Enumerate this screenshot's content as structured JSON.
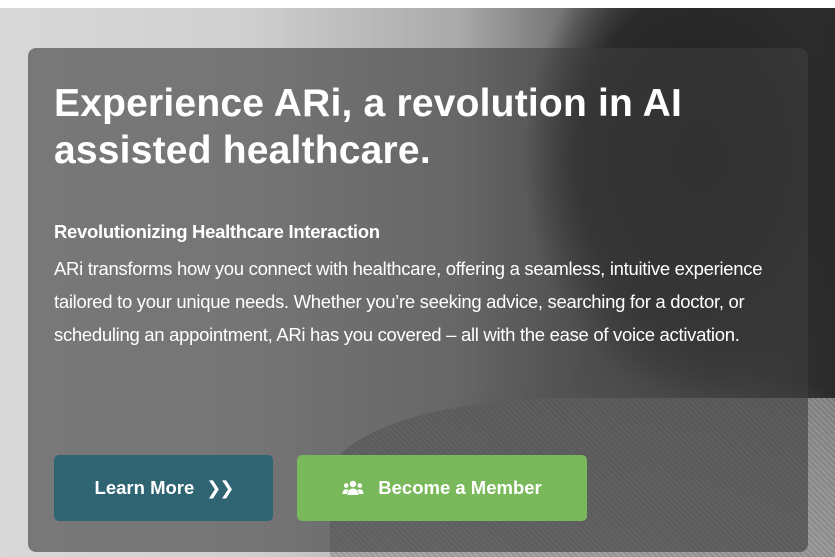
{
  "hero": {
    "title": "Experience ARi, a revolution in AI assisted healthcare.",
    "subtitle": "Revolutionizing Healthcare Interaction",
    "body": "ARi transforms how you connect with healthcare, offering a seamless, intuitive experience tailored to your unique needs. Whether you’re seeking advice, searching for a doctor, or scheduling an appointment, ARi has you covered – all with the ease of voice activation."
  },
  "buttons": {
    "learn_more": {
      "label": "Learn More",
      "icon": "double-chevron-right-icon"
    },
    "become_member": {
      "label": "Become a Member",
      "icon": "users-icon"
    }
  },
  "colors": {
    "learn_more_bg": "#2f6473",
    "become_member_bg": "#7ab85c",
    "card_overlay": "#3e3e3e"
  }
}
